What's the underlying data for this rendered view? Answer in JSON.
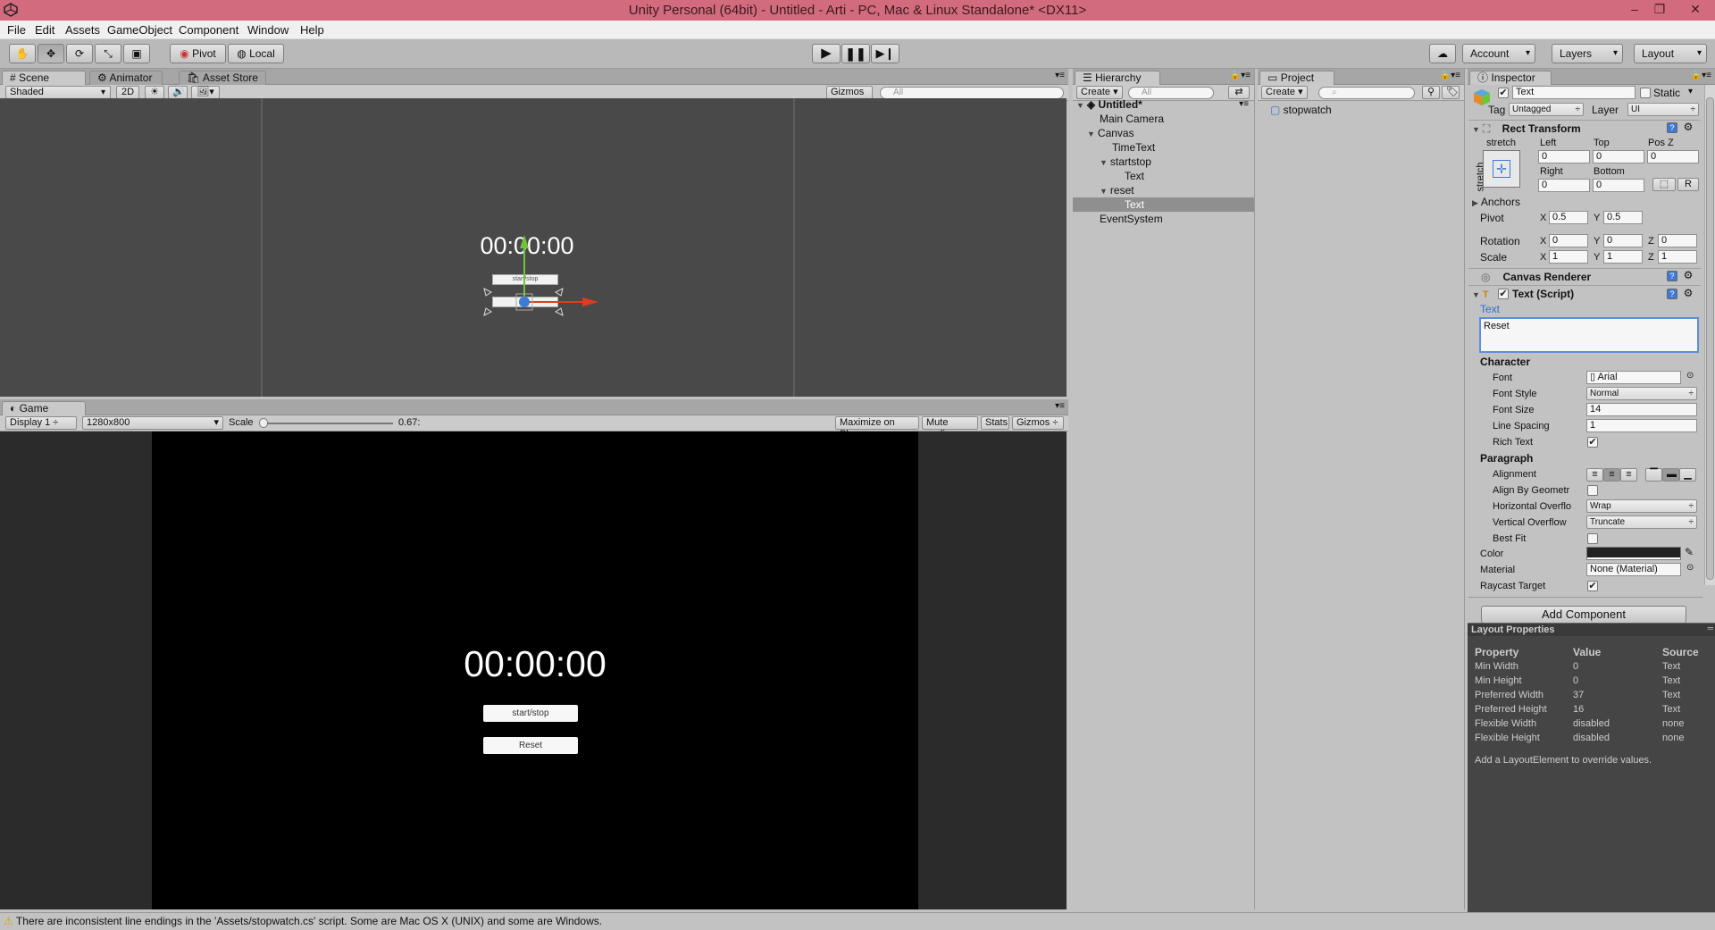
{
  "window": {
    "title": "Unity Personal (64bit) - Untitled - Arti - PC, Mac & Linux Standalone* <DX11>",
    "minimize": "–",
    "restore": "❐",
    "close": "✕"
  },
  "menu": [
    "File",
    "Edit",
    "Assets",
    "GameObject",
    "Component",
    "Window",
    "Help"
  ],
  "toolbar": {
    "pivot": "Pivot",
    "local": "Local",
    "account": "Account",
    "layers": "Layers",
    "layout": "Layout"
  },
  "scene": {
    "tabs": [
      "Scene",
      "Animator",
      "Asset Store"
    ],
    "shading": "Shaded",
    "mode2d": "2D",
    "gizmos": "Gizmos",
    "search_placeholder": "All",
    "timer_text": "00:00:00",
    "button_label": "start/stop"
  },
  "game": {
    "tab": "Game",
    "display": "Display 1",
    "resolution": "1280x800",
    "scale_label": "Scale",
    "scale_value": "0.67:",
    "maximize": "Maximize on Play",
    "mute": "Mute audio",
    "stats": "Stats",
    "gizmos": "Gizmos",
    "timer_text": "00:00:00",
    "startstop_label": "start/stop",
    "reset_label": "Reset"
  },
  "hierarchy": {
    "tab": "Hierarchy",
    "create": "Create",
    "search_placeholder": "All",
    "scene_name": "Untitled*",
    "items": [
      "Main Camera",
      "Canvas",
      "TimeText",
      "startstop",
      "Text",
      "reset",
      "Text",
      "EventSystem"
    ]
  },
  "project": {
    "tab": "Project",
    "create": "Create",
    "asset": "stopwatch"
  },
  "inspector": {
    "tab": "Inspector",
    "object_name": "Text",
    "static": "Static",
    "tag_label": "Tag",
    "tag_value": "Untagged",
    "layer_label": "Layer",
    "layer_value": "UI",
    "rect_transform": {
      "title": "Rect Transform",
      "stretch": "stretch",
      "left_label": "Left",
      "top_label": "Top",
      "posz_label": "Pos Z",
      "left": "0",
      "top": "0",
      "posz": "0",
      "right_label": "Right",
      "bottom_label": "Bottom",
      "right": "0",
      "bottom": "0",
      "r_button": "R",
      "anchors": "Anchors",
      "pivot_label": "Pivot",
      "pivot_x": "0.5",
      "pivot_y": "0.5",
      "rotation_label": "Rotation",
      "rot_x": "0",
      "rot_y": "0",
      "rot_z": "0",
      "scale_label": "Scale",
      "scale_x": "1",
      "scale_y": "1",
      "scale_z": "1",
      "x": "X",
      "y": "Y",
      "z": "Z"
    },
    "canvas_renderer": "Canvas Renderer",
    "text_script": {
      "title": "Text (Script)",
      "text_label": "Text",
      "text_value": "Reset",
      "character": "Character",
      "font_label": "Font",
      "font_value": "Arial",
      "font_style_label": "Font Style",
      "font_style_value": "Normal",
      "font_size_label": "Font Size",
      "font_size_value": "14",
      "line_spacing_label": "Line Spacing",
      "line_spacing_value": "1",
      "rich_text_label": "Rich Text",
      "paragraph": "Paragraph",
      "alignment_label": "Alignment",
      "align_geometry_label": "Align By Geometr",
      "hoverflow_label": "Horizontal Overflo",
      "hoverflow_value": "Wrap",
      "voverflow_label": "Vertical Overflow",
      "voverflow_value": "Truncate",
      "best_fit_label": "Best Fit",
      "color_label": "Color",
      "material_label": "Material",
      "material_value": "None (Material)",
      "raycast_label": "Raycast Target"
    },
    "add_component": "Add Component",
    "layout_properties": {
      "title": "Layout Properties",
      "headers": [
        "Property",
        "Value",
        "Source"
      ],
      "rows": [
        [
          "Min Width",
          "0",
          "Text"
        ],
        [
          "Min Height",
          "0",
          "Text"
        ],
        [
          "Preferred Width",
          "37",
          "Text"
        ],
        [
          "Preferred Height",
          "16",
          "Text"
        ],
        [
          "Flexible Width",
          "disabled",
          "none"
        ],
        [
          "Flexible Height",
          "disabled",
          "none"
        ]
      ],
      "note": "Add a LayoutElement to override values."
    }
  },
  "status": {
    "message": "There are inconsistent line endings in the 'Assets/stopwatch.cs' script. Some are Mac OS X (UNIX) and some are Windows."
  },
  "colors": {
    "titlebar": "#d26b7e",
    "selection": "#8f8f8f",
    "accent_blue": "#3d7ad6",
    "gizmo_green": "#6fc43a",
    "gizmo_red": "#e23b1e"
  }
}
